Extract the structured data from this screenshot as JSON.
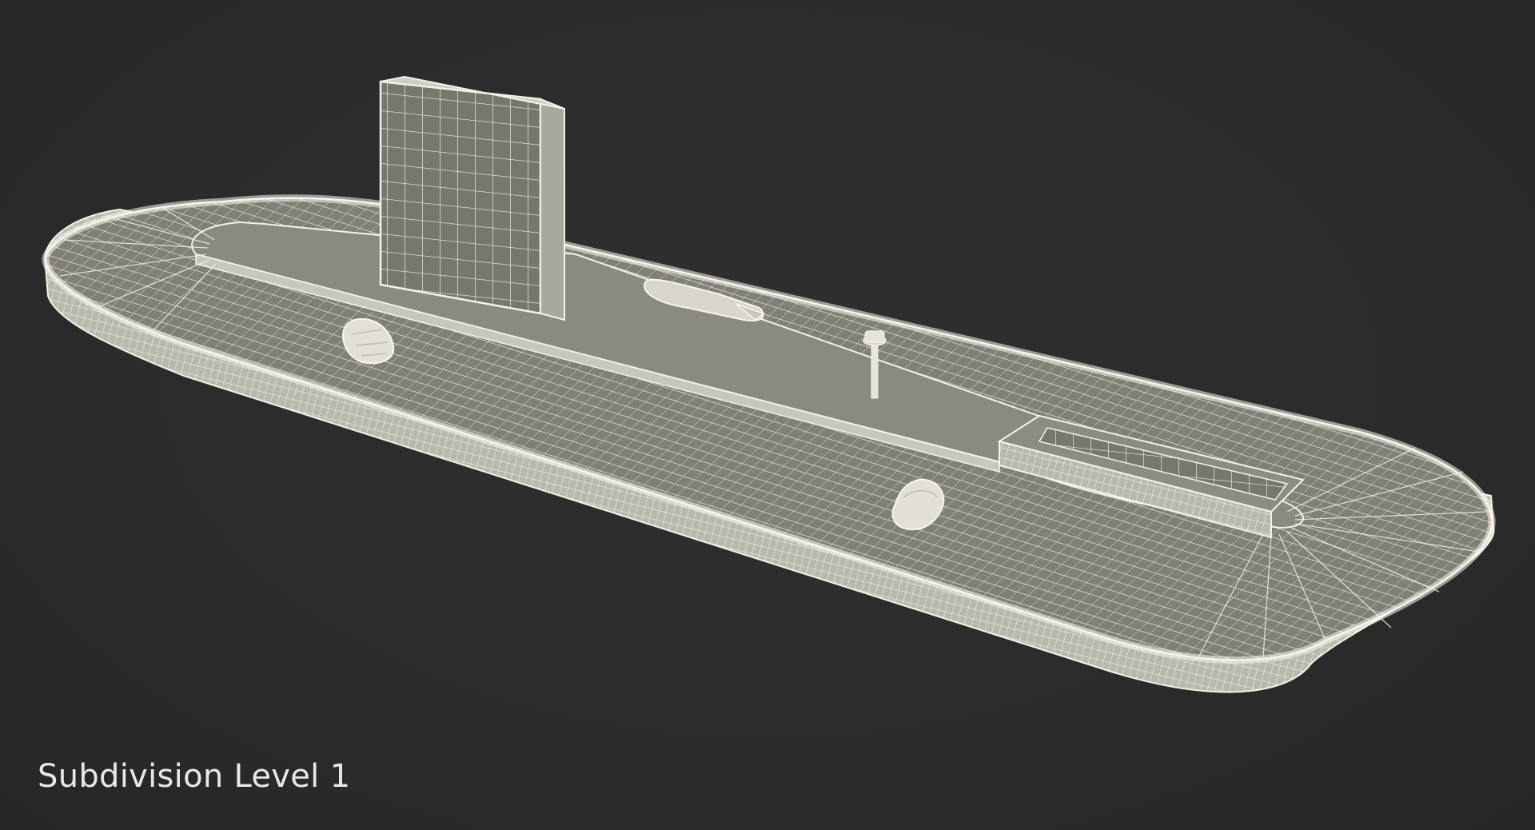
{
  "caption": "Subdivision Level 1",
  "colors": {
    "background": "#2b2b2b",
    "mesh_fill": "#7a7a70",
    "mesh_fill_light": "#8e8e84",
    "mesh_fill_dark": "#5f5f58",
    "wire": "#f4f2e6",
    "caption_text": "#e8e8e8"
  },
  "model": {
    "subject": "baggage-carousel-wireframe",
    "objects": [
      "carousel-track",
      "display-sign",
      "luggage-bag-left",
      "luggage-bag-right",
      "long-bag",
      "beacon-light",
      "feed-chute"
    ]
  }
}
